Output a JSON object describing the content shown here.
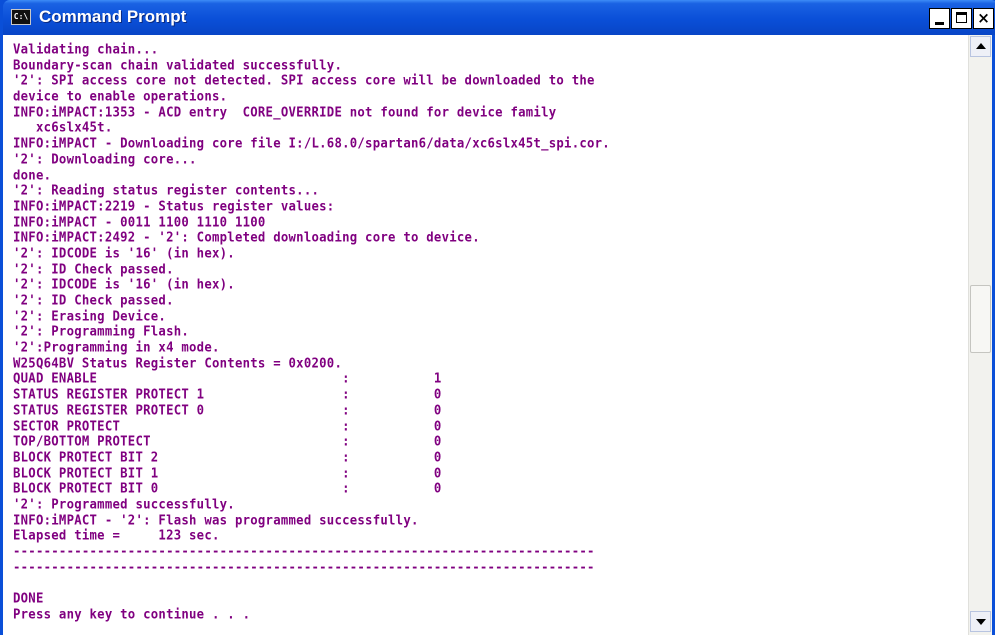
{
  "window": {
    "title": "Command Prompt",
    "icon_label": "C:\\",
    "controls": {
      "minimize": "minimize",
      "maximize": "maximize",
      "close": "×"
    }
  },
  "console": {
    "lines": [
      "Validating chain...",
      "Boundary-scan chain validated successfully.",
      "'2': SPI access core not detected. SPI access core will be downloaded to the",
      "device to enable operations.",
      "INFO:iMPACT:1353 - ACD entry  CORE_OVERRIDE not found for device family",
      "   xc6slx45t.",
      "INFO:iMPACT - Downloading core file I:/L.68.0/spartan6/data/xc6slx45t_spi.cor.",
      "'2': Downloading core...",
      "done.",
      "'2': Reading status register contents...",
      "INFO:iMPACT:2219 - Status register values:",
      "INFO:iMPACT - 0011 1100 1110 1100",
      "INFO:iMPACT:2492 - '2': Completed downloading core to device.",
      "'2': IDCODE is '16' (in hex).",
      "'2': ID Check passed.",
      "'2': IDCODE is '16' (in hex).",
      "'2': ID Check passed.",
      "'2': Erasing Device.",
      "'2': Programming Flash.",
      "'2':Programming in x4 mode.",
      "W25Q64BV Status Register Contents = 0x0200.",
      "QUAD ENABLE                                :           1",
      "STATUS REGISTER PROTECT 1                  :           0",
      "STATUS REGISTER PROTECT 0                  :           0",
      "SECTOR PROTECT                             :           0",
      "TOP/BOTTOM PROTECT                         :           0",
      "BLOCK PROTECT BIT 2                        :           0",
      "BLOCK PROTECT BIT 1                        :           0",
      "BLOCK PROTECT BIT 0                        :           0",
      "'2': Programmed successfully.",
      "INFO:iMPACT - '2': Flash was programmed successfully.",
      "Elapsed time =     123 sec.",
      "----------------------------------------------------------------------------",
      "----------------------------------------------------------------------------",
      "",
      "DONE",
      "Press any key to continue . . ."
    ]
  },
  "scrollbar": {
    "position_fraction": 0.47
  },
  "colors": {
    "text": "#800080",
    "background": "#ffffff",
    "titlebar": "#0a4fd8"
  }
}
